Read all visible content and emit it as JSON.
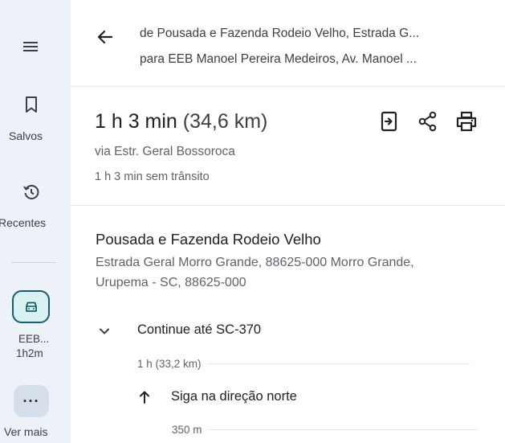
{
  "rail": {
    "saved_label": "Salvos",
    "recent_label": "Recentes",
    "trip_label": "EEB...",
    "trip_time": "1h2m",
    "more_label": "Ver mais"
  },
  "route": {
    "from": "de Pousada e Fazenda Rodeio Velho, Estrada G...",
    "to": "para EEB Manoel Pereira Medeiros, Av. Manoel ..."
  },
  "summary": {
    "duration": "1 h 3 min",
    "distance": "(34,6 km)",
    "via": "via Estr. Geral Bossoroca",
    "no_traffic": "1 h 3 min sem trânsito"
  },
  "start": {
    "name": "Pousada e Fazenda Rodeio Velho",
    "address": "Estrada Geral Morro Grande, 88625-000 Morro Grande, Urupema - SC, 88625-000"
  },
  "steps": [
    {
      "text": "Continue até SC-370",
      "distance": "1 h (33,2 km)"
    },
    {
      "text": "Siga na direção norte",
      "distance": "350 m"
    }
  ],
  "colors": {
    "rail_bg": "#ecf2f8",
    "trip_border": "#1a5c6b",
    "trip_bg": "#d8f1f1"
  }
}
